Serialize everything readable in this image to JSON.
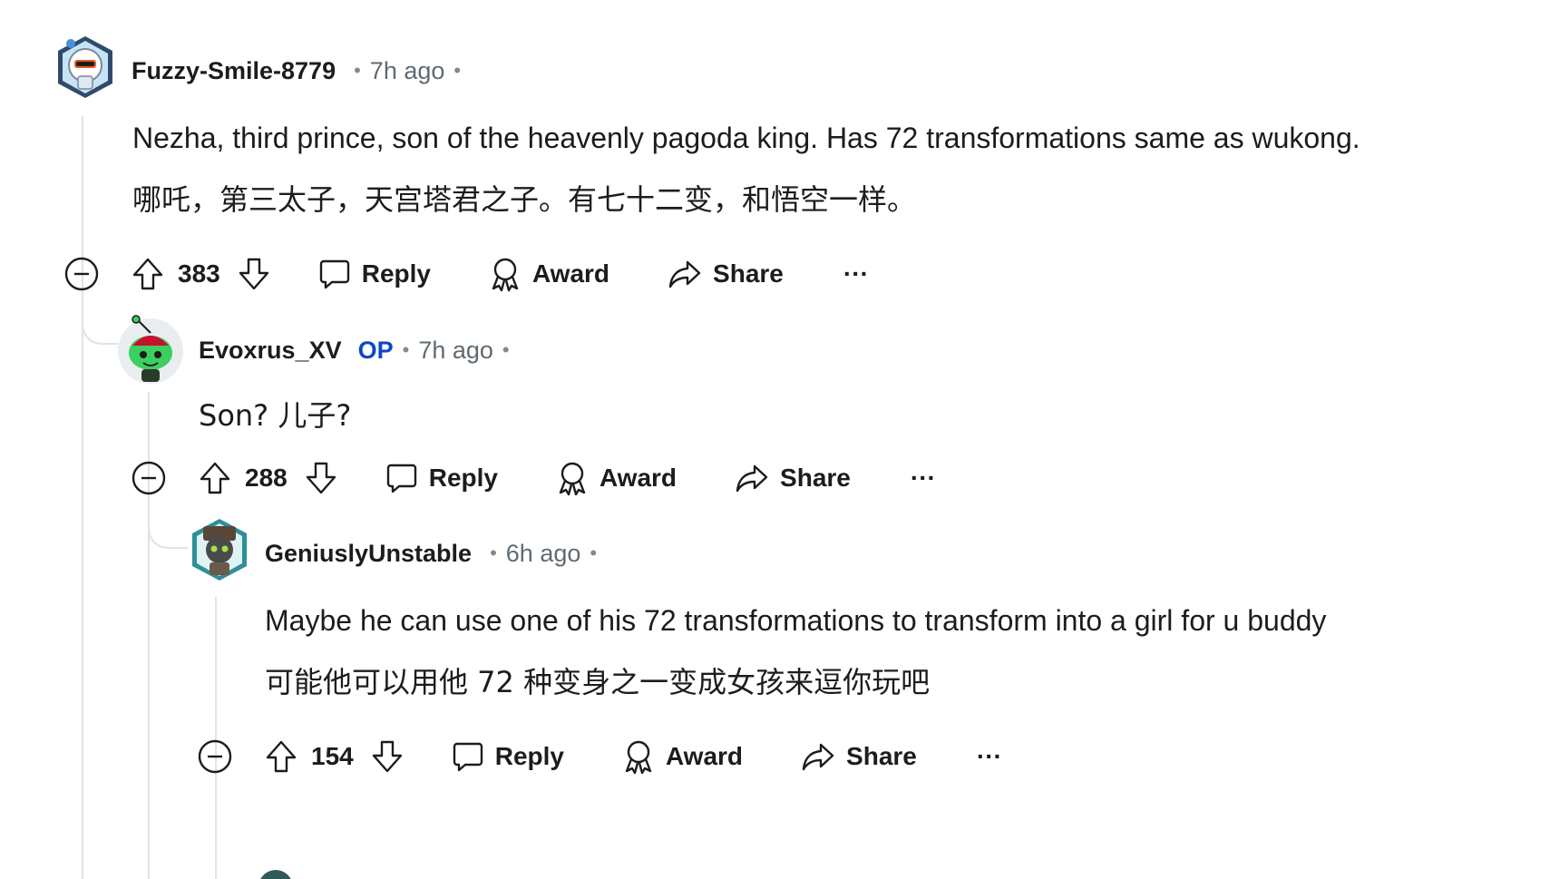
{
  "colors": {
    "op_badge": "#0a49c4",
    "thread_line": "#e2e2e2",
    "text": "#1c1c1c",
    "meta": "#5f6b73"
  },
  "comments": [
    {
      "username": "Fuzzy-Smile-8779",
      "time": "7h ago",
      "is_op": false,
      "lines": [
        "Nezha, third prince, son of the heavenly pagoda king. Has 72 transformations same as wukong.",
        "哪吒，第三太子，天宫塔君之子。有七十二变，和悟空一样。"
      ],
      "score": "383",
      "actions": {
        "reply": "Reply",
        "award": "Award",
        "share": "Share",
        "more": "···"
      }
    },
    {
      "username": "Evoxrus_XV",
      "op_label": "OP",
      "time": "7h ago",
      "is_op": true,
      "lines": [
        "Son? 儿子?"
      ],
      "score": "288",
      "actions": {
        "reply": "Reply",
        "award": "Award",
        "share": "Share",
        "more": "···"
      }
    },
    {
      "username": "GeniuslyUnstable",
      "time": "6h ago",
      "is_op": false,
      "lines": [
        "Maybe he can use one of his 72 transformations to transform into a girl for u buddy",
        "可能他可以用他 72 种变身之一变成女孩来逗你玩吧"
      ],
      "score": "154",
      "actions": {
        "reply": "Reply",
        "award": "Award",
        "share": "Share",
        "more": "···"
      }
    }
  ],
  "icons": {
    "collapse": "collapse-minus-icon",
    "upvote": "upvote-arrow-icon",
    "downvote": "downvote-arrow-icon",
    "reply": "speech-bubble-icon",
    "award": "award-ribbon-icon",
    "share": "share-arrow-icon"
  }
}
